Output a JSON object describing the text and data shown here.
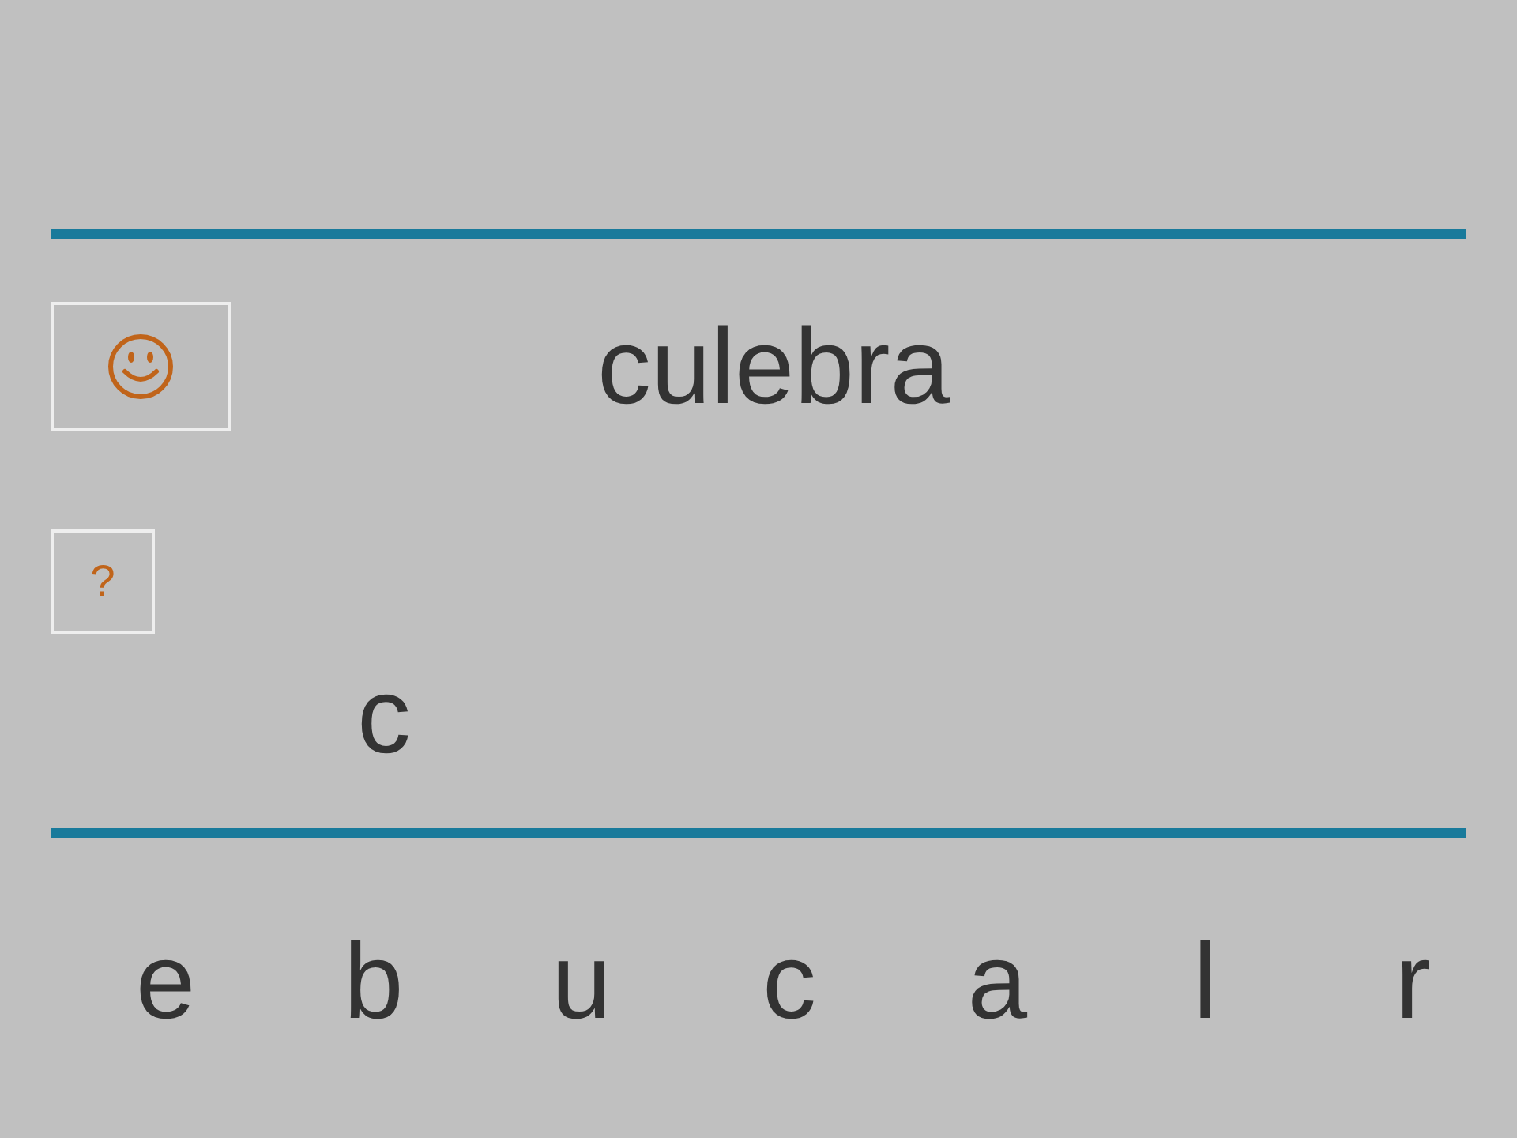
{
  "hint_button": {
    "kind": "smiley"
  },
  "word": "culebra",
  "help_button": {
    "label": "?"
  },
  "answer": [
    "c"
  ],
  "letters": [
    "e",
    "b",
    "u",
    "c",
    "a",
    "l",
    "r"
  ]
}
